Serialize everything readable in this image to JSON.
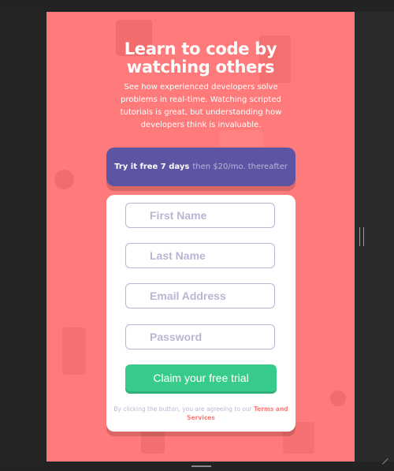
{
  "headline": {
    "line1": "Learn to code by",
    "line2": "watching others"
  },
  "subtext": "See how experienced developers solve problems in real-time. Watching scripted tutorials is great, but understanding how developers think is invaluable.",
  "promo": {
    "strong": "Try it free 7 days",
    "light": "then $20/mo. thereafter"
  },
  "form": {
    "first_name_placeholder": "First Name",
    "last_name_placeholder": "Last Name",
    "email_placeholder": "Email Address",
    "password_placeholder": "Password",
    "submit_label": "Claim your free trial",
    "terms_prefix": "By clicking the button, you are agreeing to our ",
    "terms_link": "Terms and Services"
  },
  "colors": {
    "background": "#ff7a7a",
    "promo": "#5e54a4",
    "submit": "#38cc8c",
    "placeholder": "#b9b6d3"
  }
}
